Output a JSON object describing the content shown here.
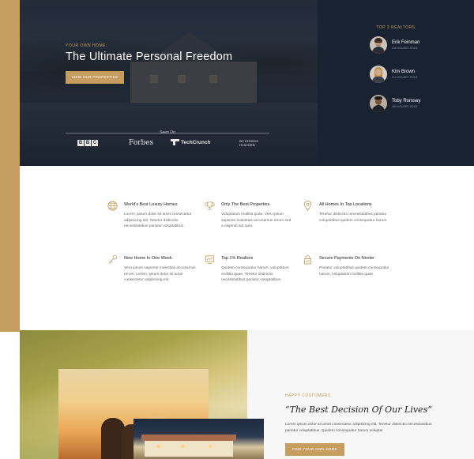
{
  "hero": {
    "kicker": "YOUR OWN HOME:",
    "title": "The Ultimate Personal Freedom",
    "button": "VIEW OUR PROPERTIES",
    "seen_on": "Seen On",
    "logos": {
      "bbc": [
        "B",
        "B",
        "C"
      ],
      "forbes": "Forbes",
      "techcrunch": "TechCrunch",
      "business_insider_line1": "BUSINESS",
      "business_insider_line2": "INSIDER"
    }
  },
  "realtors": {
    "title": "TOP 3 REALTORS",
    "items": [
      {
        "name": "Erik Feinman",
        "meta": "240 HOUSES SOLD"
      },
      {
        "name": "Kim Brown",
        "meta": "214 HOUSES SOLD"
      },
      {
        "name": "Toby Romsey",
        "meta": "189 HOUSES SOLD"
      }
    ]
  },
  "features": [
    {
      "icon": "globe-icon",
      "title": "World's Best Luxury Homes",
      "text": "Lorem, ipsum dolor sit amet consectetur adipisicing elit. Tenetur distinctio necessitatibus pariatur voluptatibus."
    },
    {
      "icon": "trophy-icon",
      "title": "Only The Best Properties",
      "text": "Voluptatum mollitia quae. Vero ipsum sapiente molestias accusamus rerum sed a eligendi aut quia."
    },
    {
      "icon": "map-pin-icon",
      "title": "All Homes In Top Locations",
      "text": "Tenetur distinctio necessitatibus pariatur voluptatibus quidem consequatur harum."
    },
    {
      "icon": "key-icon",
      "title": "New Home In One Week",
      "text": "Vero ipsum sapiente molestias accusamus rerum. Lorem, ipsum dolor sit amet consectetur adipisicing elit."
    },
    {
      "icon": "chart-icon",
      "title": "Top 1% Realtors",
      "text": "Quidem consequatur harum, voluptatum mollitia quae. Tenetur distinctio necessitatibus pariatur voluptatibus."
    },
    {
      "icon": "lock-icon",
      "title": "Secure Payments On Nexter",
      "text": "Pariatur voluptatibus quidem consequatur harum, voluptatum mollitia quae."
    }
  ],
  "testimonial": {
    "kicker": "HAPPY CUSTOMERS",
    "quote": "“The Best Decision Of Our Lives”",
    "text": "Lorem ipsum dolor sit amet consectetur adipisicing elit. Tenetur distinctio necessitatibus pariatur voluptatibus. Quidem consequatur harum volupta!",
    "button": "FIND YOUR OWN HOME"
  },
  "colors": {
    "accent": "#c59d5f",
    "navy": "#182230",
    "background_light": "#f7f7f7"
  }
}
